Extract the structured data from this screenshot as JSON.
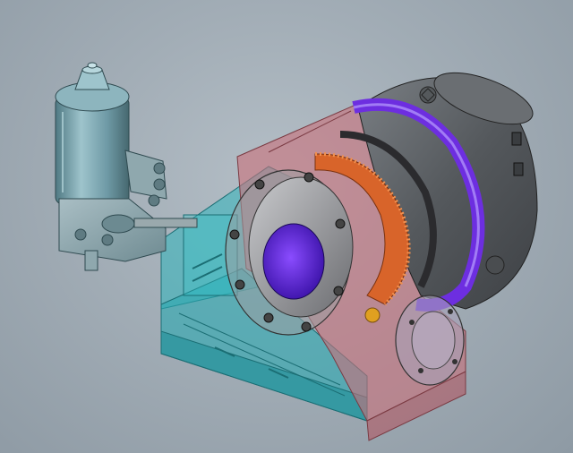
{
  "viewport": {
    "background": "#a6b1ba"
  },
  "model": {
    "parts": [
      {
        "name": "drive-motor",
        "color": "#6f9aa6"
      },
      {
        "name": "gearbox-housing",
        "color": "#9fb4bb"
      },
      {
        "name": "base-housing",
        "color": "#2fb4bc"
      },
      {
        "name": "sectioned-housing",
        "color": "#c9707a"
      },
      {
        "name": "chuck-body",
        "color": "#5b5f63"
      },
      {
        "name": "ring-gear",
        "color": "#d8642a"
      },
      {
        "name": "bearing-rings",
        "color": "#6d2ee0"
      },
      {
        "name": "spindle-flange",
        "color": "#8d8e92"
      },
      {
        "name": "end-cap",
        "color": "#a9a1b8"
      }
    ],
    "palette": {
      "teal": "#2fb4bc",
      "salmon": "#c9707a",
      "purple": "#6d2ee0",
      "orange": "#d8642a",
      "steel": "#5b5f63",
      "motor": "#6f9aa6"
    }
  }
}
